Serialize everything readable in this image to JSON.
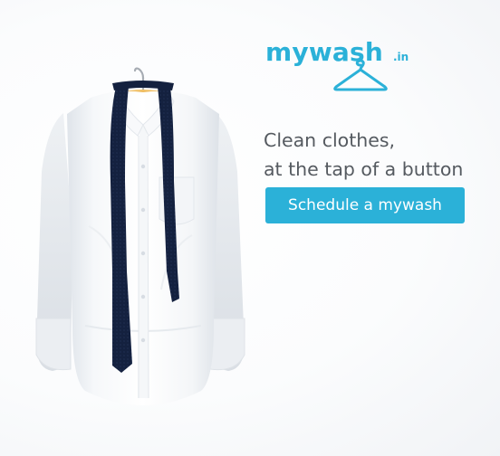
{
  "brand": {
    "name": "mywash",
    "tld": ".in",
    "color": "#2bb1d8",
    "logo_icon": "clothes-hanger-icon"
  },
  "hero": {
    "image": "white-dress-shirt-on-hanger-with-navy-tie"
  },
  "tagline": {
    "line1": "Clean clothes,",
    "line2": "at the tap of a button"
  },
  "cta": {
    "label": "Schedule a mywash"
  }
}
